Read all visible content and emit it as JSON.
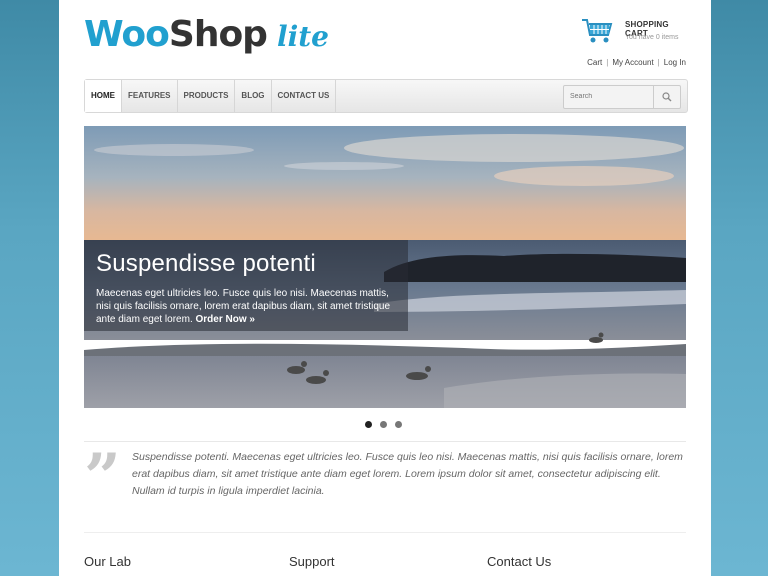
{
  "logo": {
    "woo": "Woo",
    "shop": "Shop",
    "lite": "lite"
  },
  "cart": {
    "title": "SHOPPING CART",
    "subtitle": "You have 0 items"
  },
  "account_links": {
    "cart": "Cart",
    "my_account": "My Account",
    "log_in": "Log In",
    "separator": "|"
  },
  "nav": {
    "items": [
      "HOME",
      "FEATURES",
      "PRODUCTS",
      "BLOG",
      "CONTACT US"
    ],
    "active": "HOME"
  },
  "search": {
    "placeholder": "Search"
  },
  "slider": {
    "title": "Suspendisse potenti",
    "text": "Maecenas eget ultricies leo. Fusce quis leo nisi. Maecenas mattis, nisi quis facilisis ornare, lorem erat dapibus diam, sit amet tristique ante diam eget lorem.",
    "cta": "Order Now »",
    "dots": 3,
    "active_dot": 0
  },
  "quote": {
    "mark": "”",
    "text": "Suspendisse potenti. Maecenas eget ultricies leo. Fusce quis leo nisi. Maecenas mattis, nisi quis facilisis ornare, lorem erat dapibus diam, sit amet tristique ante diam eget lorem. Lorem ipsum dolor sit amet, consectetur adipiscing elit. Nullam id turpis in ligula imperdiet lacinia."
  },
  "footer": {
    "col1": "Our Lab",
    "col2": "Support",
    "col3": "Contact Us"
  },
  "colors": {
    "brand_blue": "#21a0cf",
    "dark": "#333333"
  },
  "icons": {
    "cart": "shopping-cart-icon",
    "search": "search-icon",
    "quote": "quote-icon"
  }
}
